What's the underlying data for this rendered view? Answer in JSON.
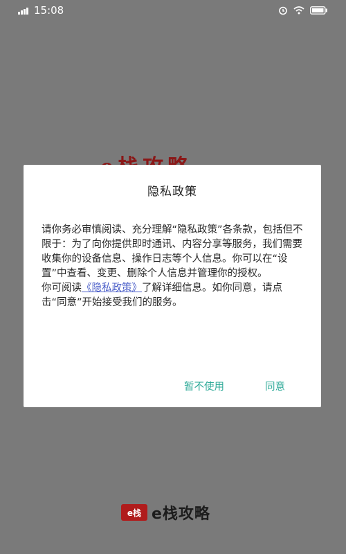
{
  "status_bar": {
    "time": "15:08",
    "icons": [
      "signal-icon",
      "wifi-icon",
      "alarm-icon",
      "battery-icon"
    ]
  },
  "splash": {
    "title": "e栈攻略"
  },
  "dialog": {
    "title": "隐私政策",
    "body_part1": "请你务必审慎阅读、充分理解“隐私政策”各条款，包括但不限于：为了向你提供即时通讯、内容分享等服务，我们需要收集你的设备信息、操作日志等个人信息。你可以在“设置”中查看、变更、删除个人信息并管理你的授权。",
    "body_read_prefix": "你可阅读",
    "policy_link": "《隐私政策》",
    "body_read_suffix": "了解详细信息。如你同意，请点击“同意”开始接受我们的服务。",
    "decline_label": "暂不使用",
    "agree_label": "同意"
  },
  "brand": {
    "badge": "e栈",
    "name": "e栈攻略"
  },
  "colors": {
    "overlay": "#7a7a7a",
    "accent": "#2aa896",
    "link": "#4a5ec8",
    "brand_red": "#b01c1c"
  }
}
